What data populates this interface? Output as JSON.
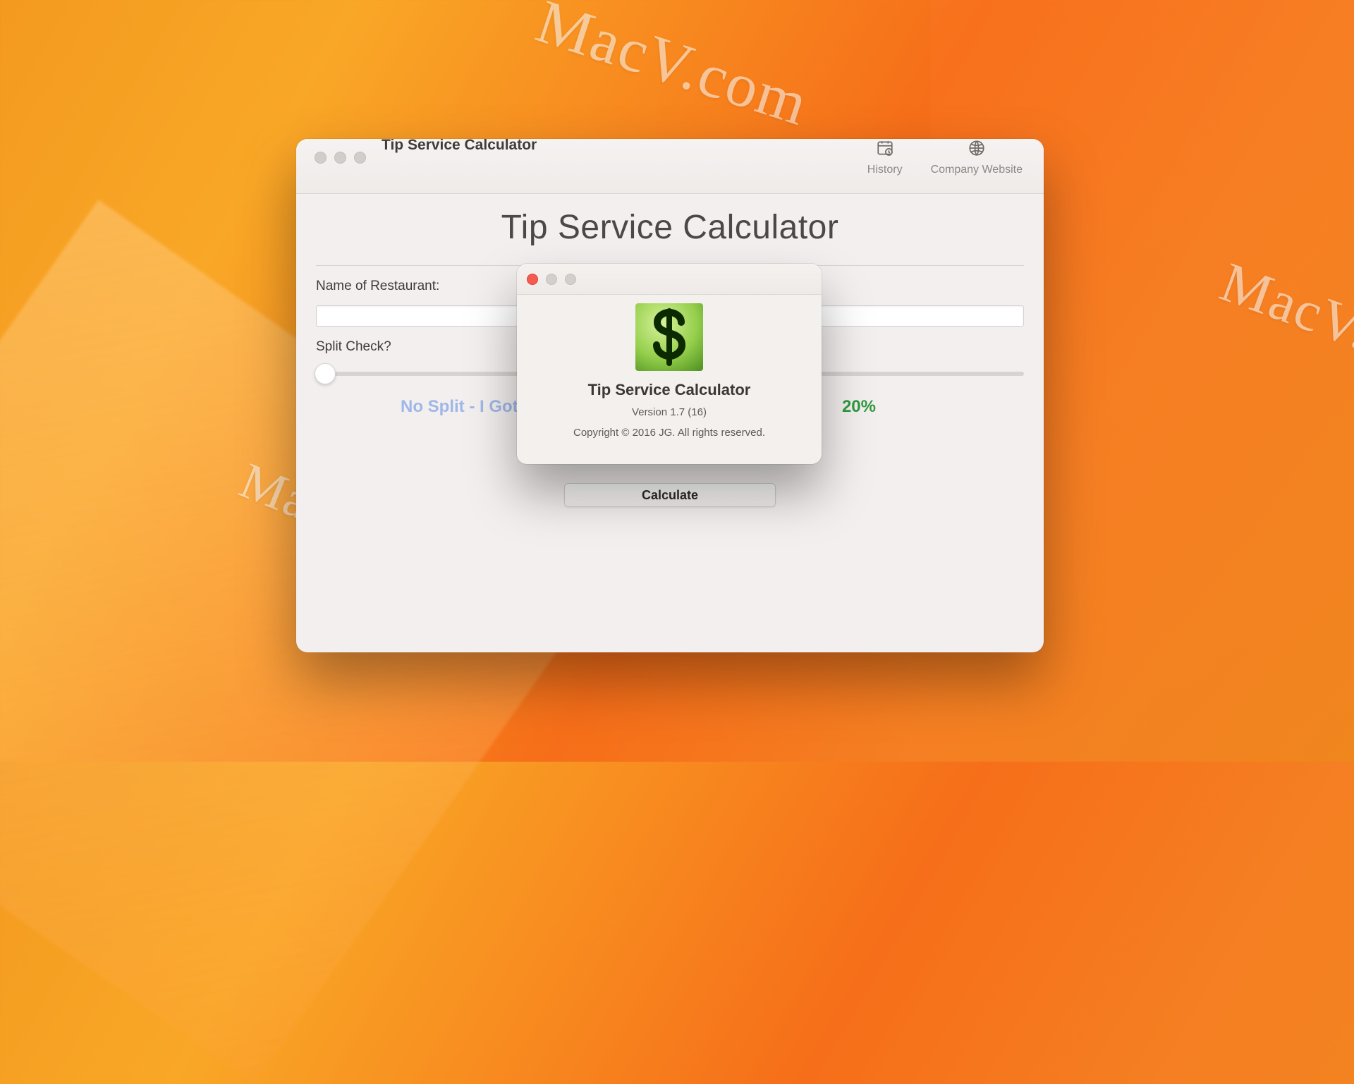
{
  "watermark": "MacV.com",
  "watermark_cut": "MacV.co",
  "window": {
    "title": "Tip Service Calculator",
    "toolbar": {
      "history_label": "History",
      "website_label": "Company Website"
    }
  },
  "page": {
    "heading": "Tip Service Calculator",
    "restaurant_label": "Name of Restaurant:",
    "restaurant_value": "",
    "split_label": "Split Check?",
    "split_value_text": "No Split - I Got",
    "tip_value_text": "20%",
    "calculate_label": "Calculate"
  },
  "about": {
    "app_name": "Tip Service Calculator",
    "version": "Version 1.7 (16)",
    "copyright": "Copyright © 2016 JG. All rights reserved."
  }
}
